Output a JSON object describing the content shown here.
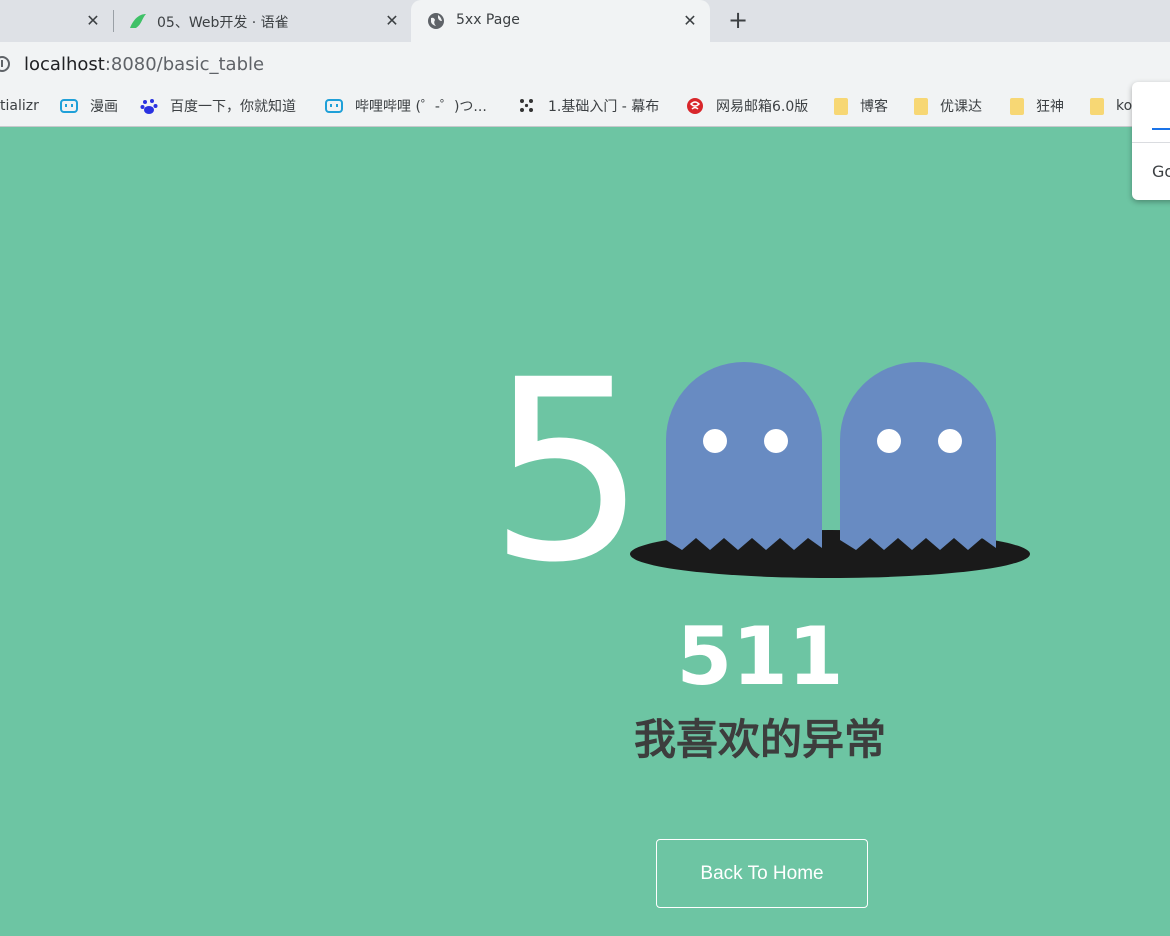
{
  "tabs": [
    {
      "title": ""
    },
    {
      "title": "05、Web开发 · 语雀"
    },
    {
      "title": "5xx Page",
      "active": true
    }
  ],
  "address": {
    "host": "localhost",
    "rest": ":8080/basic_table"
  },
  "bookmarks": [
    {
      "label": "tializr"
    },
    {
      "label": "漫画",
      "icon": "bilibili-icon"
    },
    {
      "label": "百度一下，你就知道",
      "icon": "baidu-icon"
    },
    {
      "label": "哔哩哔哩 (゜-゜)つ...",
      "icon": "bilibili-icon"
    },
    {
      "label": "1.基础入门 - 幕布",
      "icon": "mubu-icon"
    },
    {
      "label": "网易邮箱6.0版",
      "icon": "netease-icon"
    },
    {
      "label": "博客",
      "icon": "folder-icon"
    },
    {
      "label": "优课达",
      "icon": "folder-icon"
    },
    {
      "label": "狂神",
      "icon": "folder-icon"
    },
    {
      "label": "ko",
      "icon": "folder-icon"
    }
  ],
  "popup": {
    "text": "Go"
  },
  "error": {
    "big_digit": "5",
    "code": "511",
    "message": "我喜欢的异常",
    "back_button": "Back To Home"
  },
  "colors": {
    "background": "#6dc5a3",
    "ghost": "#688bc2",
    "hole": "#1a1a1a"
  }
}
